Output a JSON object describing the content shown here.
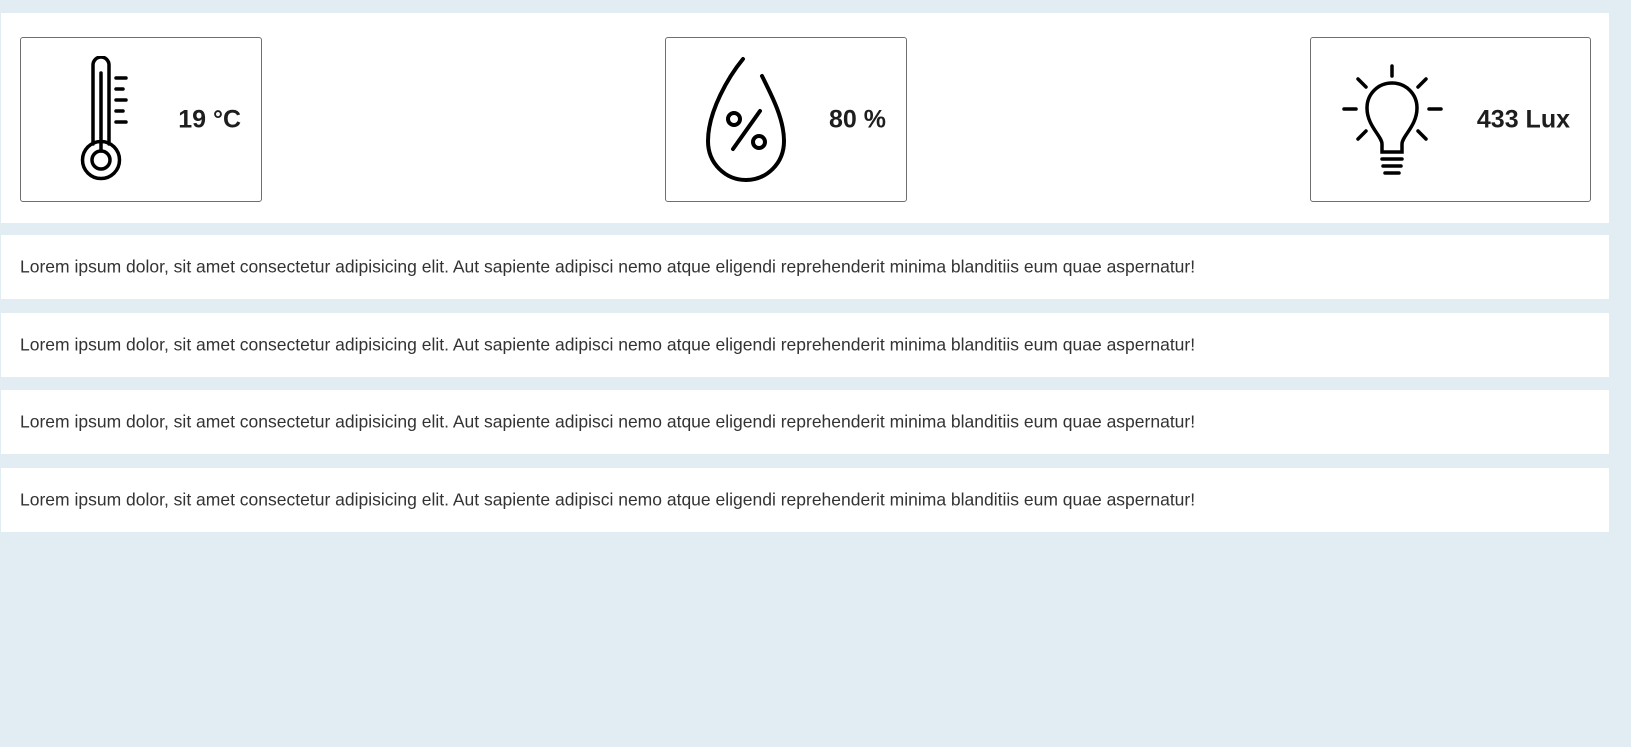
{
  "sensors": {
    "temperature": {
      "value": "19 °C",
      "icon": "thermometer-icon"
    },
    "humidity": {
      "value": "80 %",
      "icon": "humidity-drop-icon"
    },
    "light": {
      "value": "433 Lux",
      "icon": "lightbulb-icon"
    }
  },
  "rows": [
    "Lorem ipsum dolor, sit amet consectetur adipisicing elit. Aut sapiente adipisci nemo atque eligendi reprehenderit minima blanditiis eum quae aspernatur!",
    "Lorem ipsum dolor, sit amet consectetur adipisicing elit. Aut sapiente adipisci nemo atque eligendi reprehenderit minima blanditiis eum quae aspernatur!",
    "Lorem ipsum dolor, sit amet consectetur adipisicing elit. Aut sapiente adipisci nemo atque eligendi reprehenderit minima blanditiis eum quae aspernatur!",
    "Lorem ipsum dolor, sit amet consectetur adipisicing elit. Aut sapiente adipisci nemo atque eligendi reprehenderit minima blanditiis eum quae aspernatur!"
  ],
  "colors": {
    "background": "#e1ecf3",
    "panel": "#ffffff",
    "card_border": "#6f6f6f",
    "text": "#333333"
  }
}
